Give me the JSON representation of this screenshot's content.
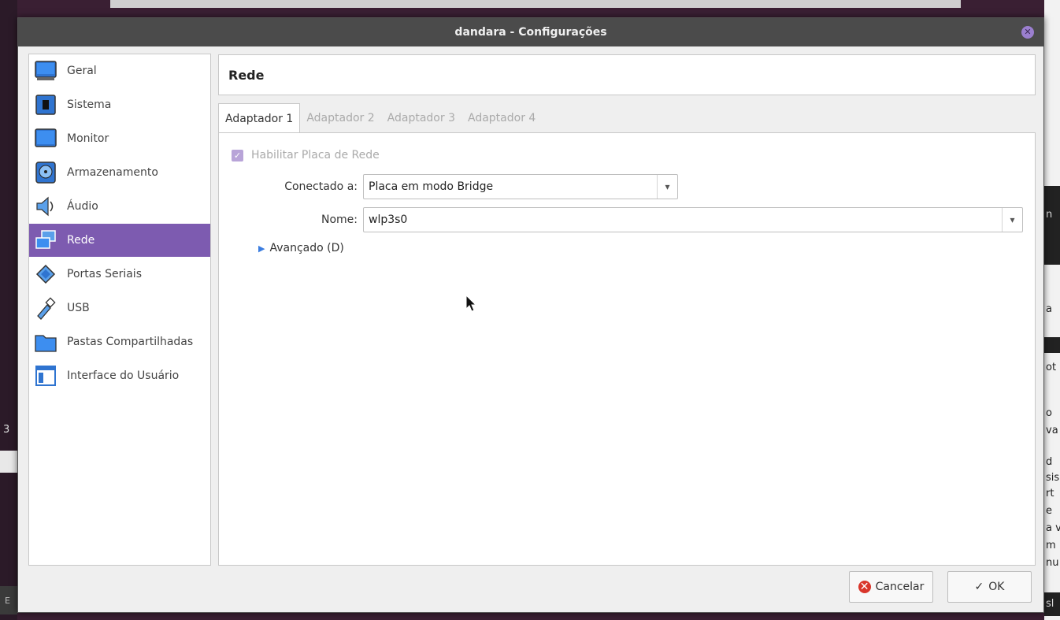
{
  "window": {
    "title": "dandara - Configurações"
  },
  "sidebar": {
    "items": [
      {
        "label": "Geral",
        "icon": "monitor-general-icon"
      },
      {
        "label": "Sistema",
        "icon": "chip-icon"
      },
      {
        "label": "Monitor",
        "icon": "display-icon"
      },
      {
        "label": "Armazenamento",
        "icon": "disk-icon"
      },
      {
        "label": "Áudio",
        "icon": "speaker-icon"
      },
      {
        "label": "Rede",
        "icon": "network-icon"
      },
      {
        "label": "Portas Seriais",
        "icon": "serial-port-icon"
      },
      {
        "label": "USB",
        "icon": "usb-icon"
      },
      {
        "label": "Pastas Compartilhadas",
        "icon": "folder-icon"
      },
      {
        "label": "Interface do Usuário",
        "icon": "window-interface-icon"
      }
    ],
    "selected": "Rede"
  },
  "header": {
    "title": "Rede"
  },
  "tabs": [
    {
      "label": "Adaptador 1"
    },
    {
      "label": "Adaptador 2"
    },
    {
      "label": "Adaptador 3"
    },
    {
      "label": "Adaptador 4"
    }
  ],
  "network": {
    "enable_label": "Habilitar Placa de Rede",
    "enable_checked": true,
    "connected_label": "Conectado a:",
    "connected_value": "Placa em modo Bridge",
    "name_label": "Nome:",
    "name_value": "wlp3s0",
    "advanced_label": "Avançado (D)"
  },
  "buttons": {
    "cancel": "Cancelar",
    "ok": "OK"
  },
  "background": {
    "left_fragment": "3",
    "right_fragments": [
      "n",
      "a",
      "ot",
      "o",
      "va",
      "d",
      "sis",
      "rt",
      "e",
      "a v",
      "m",
      "nu",
      "sl"
    ],
    "bottom_left_fragment": "E"
  },
  "colors": {
    "accent": "#7d5bb0",
    "titlebar": "#4b4b4b",
    "cancel": "#d9362b"
  }
}
